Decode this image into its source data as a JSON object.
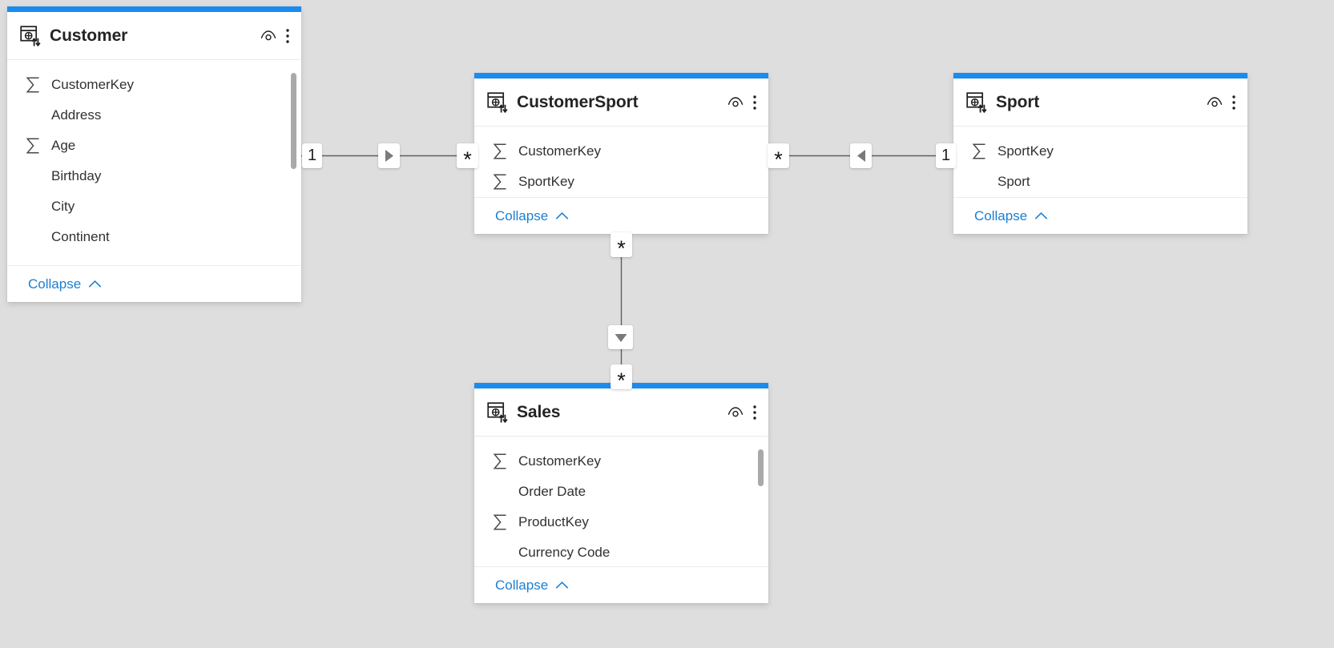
{
  "canvas": {
    "background": "#dfdede",
    "accent_color": "#1b8bf0",
    "link_color": "#605e5c",
    "link_text_color": "#1b7fd1"
  },
  "tables": [
    {
      "id": "customer",
      "name": "Customer",
      "icon": "directquery-table-icon",
      "collapse_label": "Collapse",
      "fields": [
        {
          "name": "CustomerKey",
          "aggregate": true
        },
        {
          "name": "Address",
          "aggregate": false
        },
        {
          "name": "Age",
          "aggregate": true
        },
        {
          "name": "Birthday",
          "aggregate": false
        },
        {
          "name": "City",
          "aggregate": false
        },
        {
          "name": "Continent",
          "aggregate": false
        }
      ]
    },
    {
      "id": "customersport",
      "name": "CustomerSport",
      "icon": "directquery-table-icon",
      "collapse_label": "Collapse",
      "fields": [
        {
          "name": "CustomerKey",
          "aggregate": true
        },
        {
          "name": "SportKey",
          "aggregate": true
        }
      ]
    },
    {
      "id": "sport",
      "name": "Sport",
      "icon": "directquery-table-icon",
      "collapse_label": "Collapse",
      "fields": [
        {
          "name": "SportKey",
          "aggregate": true
        },
        {
          "name": "Sport",
          "aggregate": false
        }
      ]
    },
    {
      "id": "sales",
      "name": "Sales",
      "icon": "directquery-table-icon",
      "collapse_label": "Collapse",
      "fields": [
        {
          "name": "CustomerKey",
          "aggregate": true
        },
        {
          "name": "Order Date",
          "aggregate": false
        },
        {
          "name": "ProductKey",
          "aggregate": true
        },
        {
          "name": "Currency Code",
          "aggregate": false
        }
      ]
    }
  ],
  "relationships": [
    {
      "id": "customer-customersport",
      "from_table": "Customer",
      "to_table": "CustomerSport",
      "from_cardinality": "1",
      "to_cardinality": "*",
      "cross_filter": "single",
      "arrow": "right"
    },
    {
      "id": "customersport-sport",
      "from_table": "CustomerSport",
      "to_table": "Sport",
      "from_cardinality": "*",
      "to_cardinality": "1",
      "cross_filter": "single",
      "arrow": "left"
    },
    {
      "id": "customersport-sales",
      "from_table": "CustomerSport",
      "to_table": "Sales",
      "from_cardinality": "*",
      "to_cardinality": "*",
      "cross_filter": "single",
      "arrow": "down"
    }
  ],
  "icons": {
    "eye": "show-hide-eye-icon",
    "kebab": "more-options-icon",
    "sigma": "summarization-sigma-icon",
    "chevron_up": "chevron-up-icon"
  }
}
